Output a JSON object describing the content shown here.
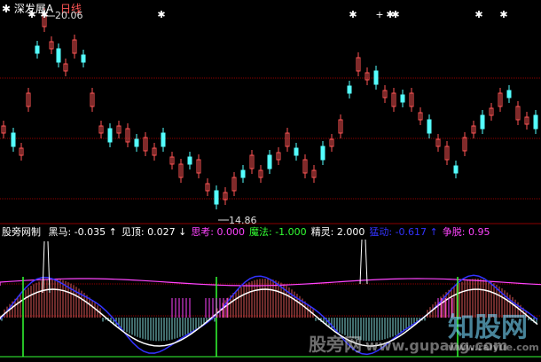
{
  "header": {
    "stock": "深发展A",
    "period": "日线"
  },
  "price_high": "20.06",
  "price_low": "14.86",
  "indicator": {
    "title": "股旁网制",
    "items": [
      {
        "label": "黑马:",
        "value": "-0.035",
        "arrow": "↑",
        "color": "#ffffff"
      },
      {
        "label": "见顶:",
        "value": "0.027",
        "arrow": "↓",
        "color": "#ffffff"
      },
      {
        "label": "思考:",
        "value": "0.000",
        "arrow": "",
        "color": "#ff44ff"
      },
      {
        "label": "魔法:",
        "value": "-1.000",
        "arrow": "",
        "color": "#33ff33"
      },
      {
        "label": "精灵:",
        "value": "2.000",
        "arrow": "",
        "color": "#ffffff"
      },
      {
        "label": "猛动:",
        "value": "-0.617",
        "arrow": "↑",
        "color": "#3333ff"
      },
      {
        "label": "争脱:",
        "value": "0.95",
        "arrow": "",
        "color": "#ff44ff"
      }
    ]
  },
  "watermark": {
    "left": "股旁网",
    "url": "www.gupang.com",
    "right": "知股网",
    "right_url": "www.raiyue.com"
  },
  "colors": {
    "up": "#ff5555",
    "down": "#54ffff",
    "grid": "#8b0000",
    "star": "#ffffff"
  }
}
